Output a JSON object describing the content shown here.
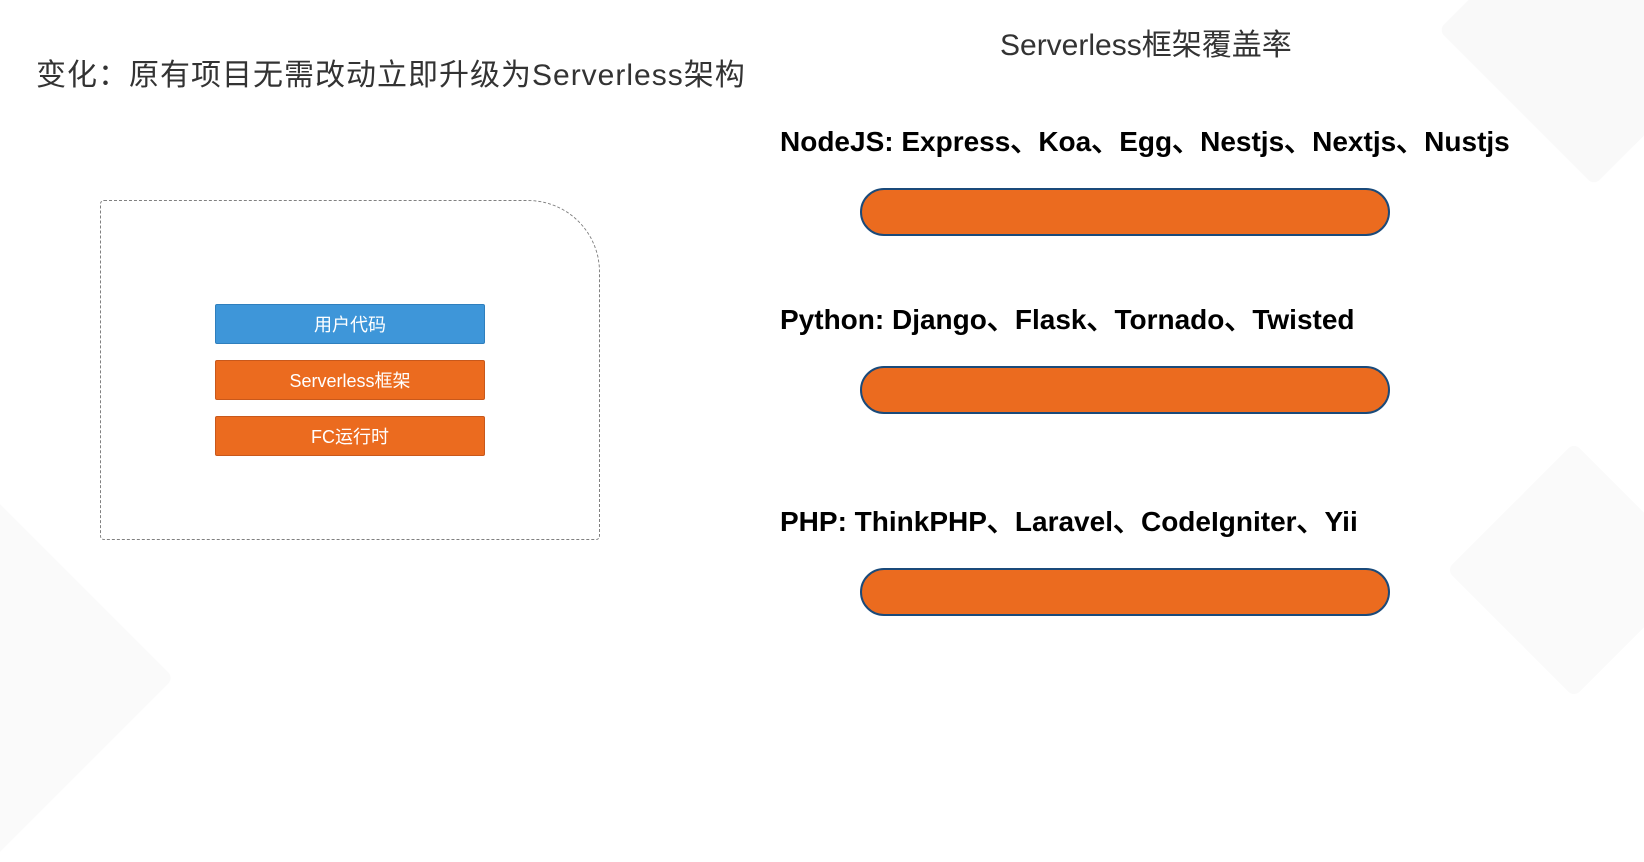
{
  "left_title": "变化：原有项目无需改动立即升级为Serverless架构",
  "arch": {
    "layer_user_code": "用户代码",
    "layer_serverless": "Serverless框架",
    "layer_runtime": "FC运行时"
  },
  "right_title": "Serverless框架覆盖率",
  "frameworks": {
    "nodejs_label": "NodeJS: Express、Koa、Egg、Nestjs、Nextjs、Nustjs",
    "python_label": "Python: Django、Flask、Tornado、Twisted",
    "php_label": "PHP: ThinkPHP、Laravel、CodeIgniter、Yii"
  },
  "colors": {
    "orange": "#eb6b1f",
    "blue": "#3e96d9",
    "bar_border": "#1a4a7a"
  }
}
